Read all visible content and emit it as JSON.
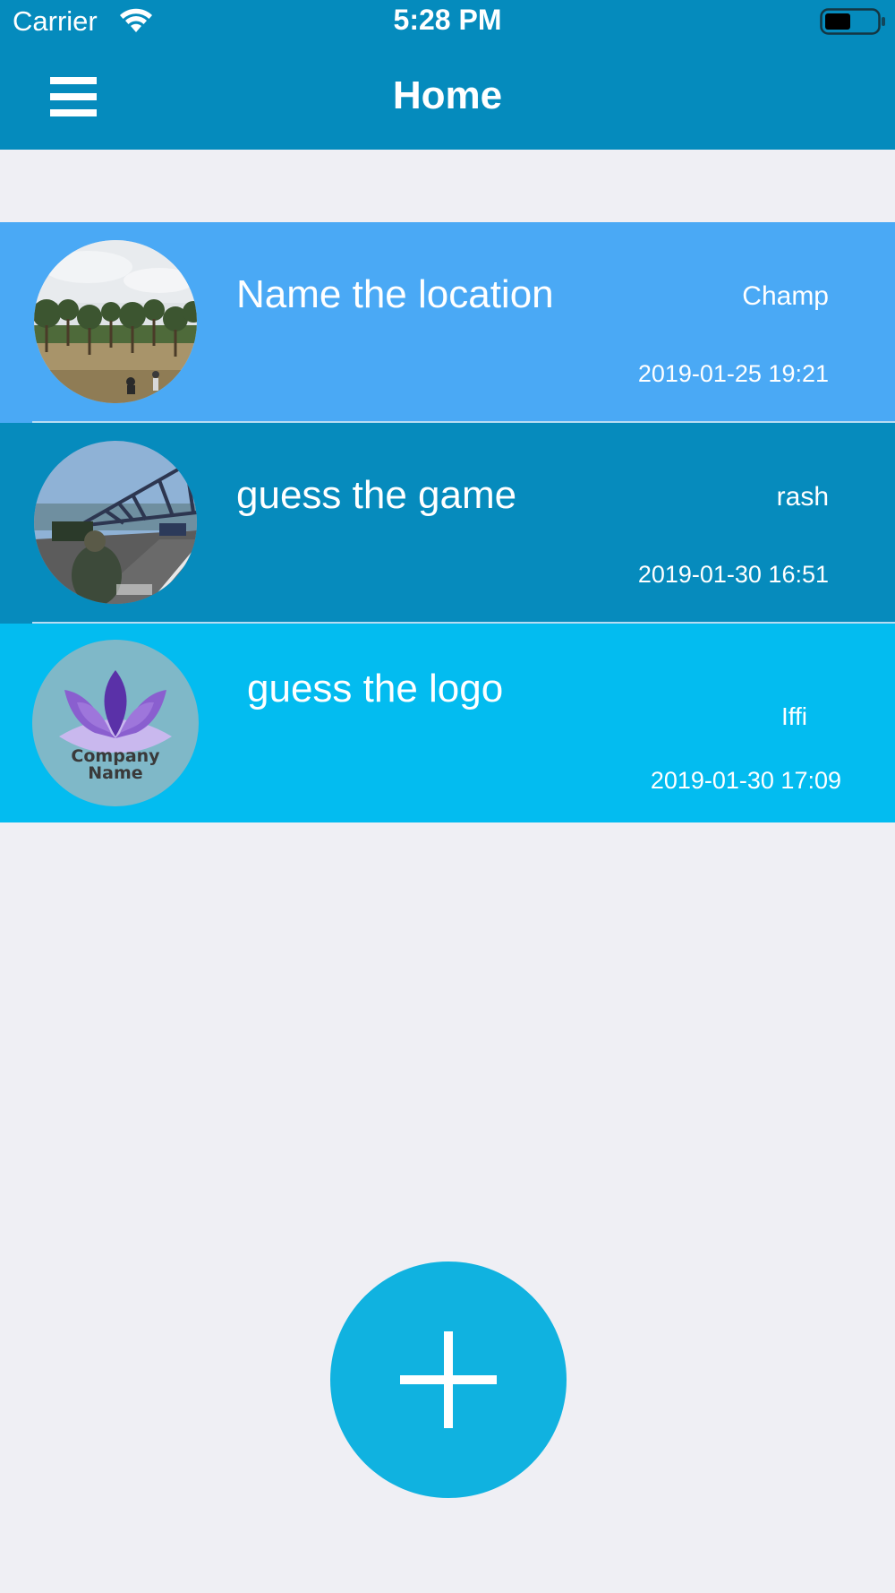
{
  "status_bar": {
    "carrier": "Carrier",
    "wifi_icon": "wifi-icon",
    "time": "5:28 PM",
    "battery_icon": "battery-icon"
  },
  "nav_bar": {
    "menu_icon": "hamburger-menu-icon",
    "title": "Home",
    "background_color": "#058bbd"
  },
  "posts": [
    {
      "title": "Name the location",
      "author": "Champ",
      "date": "2019-01-25 19:21",
      "thumbnail": "landscape-photo-thumbnail",
      "background_color": "#4aa9f5"
    },
    {
      "title": "guess the game",
      "author": "rash",
      "date": "2019-01-30 16:51",
      "thumbnail": "game-screenshot-thumbnail",
      "background_color": "#068bbd"
    },
    {
      "title": "guess the logo",
      "author": "Iffi",
      "date": "2019-01-30 17:09",
      "thumbnail": "company-logo-thumbnail",
      "thumbnail_text": [
        "Company",
        "Name"
      ],
      "background_color": "#03bcf0"
    }
  ],
  "add_button": {
    "icon": "plus-icon",
    "color": "#10b2e0"
  },
  "page_background": "#efeff4"
}
